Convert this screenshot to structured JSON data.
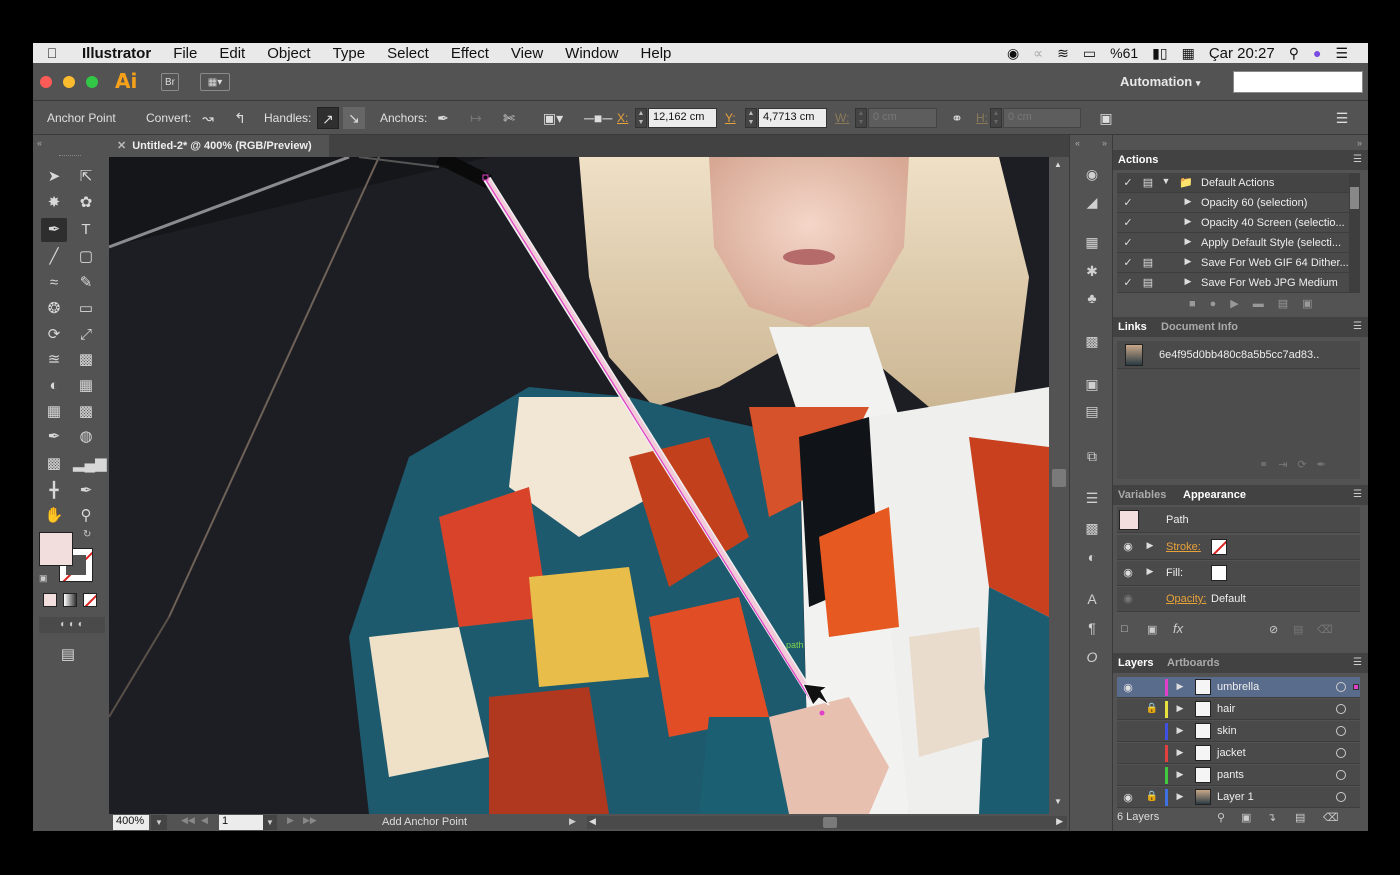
{
  "menubar": {
    "app_name": "Illustrator",
    "items": [
      "File",
      "Edit",
      "Object",
      "Type",
      "Select",
      "Effect",
      "View",
      "Window",
      "Help"
    ],
    "battery": "%61",
    "clock": "Çar 20:27"
  },
  "appbar": {
    "logo": "Ai",
    "bridge_label": "Br",
    "workspace": "Automation",
    "search_placeholder": ""
  },
  "control_bar": {
    "tool_name": "Anchor Point",
    "convert_label": "Convert:",
    "handles_label": "Handles:",
    "anchors_label": "Anchors:",
    "x_label": "X:",
    "x_value": "12,162 cm",
    "y_label": "Y:",
    "y_value": "4,7713 cm",
    "w_label": "W:",
    "w_value": "0 cm",
    "h_label": "H:",
    "h_value": "0 cm"
  },
  "document": {
    "tab_title": "Untitled-2* @ 400% (RGB/Preview)",
    "smart_guide_label": "path"
  },
  "status_bar": {
    "zoom": "400%",
    "artboard": "1",
    "current_tool": "Add Anchor Point"
  },
  "actions_panel": {
    "title": "Actions",
    "set_name": "Default Actions",
    "items": [
      "Opacity 60 (selection)",
      "Opacity 40 Screen (selectio...",
      "Apply Default Style (selecti...",
      "Save For Web GIF 64 Dither...",
      "Save For Web JPG Medium"
    ]
  },
  "links_panel": {
    "tab_links": "Links",
    "tab_doc_info": "Document Info",
    "link_name": "6e4f95d0bb480c8a5b5cc7ad83.."
  },
  "appearance_panel": {
    "tab_variables": "Variables",
    "tab_appearance": "Appearance",
    "object_type": "Path",
    "stroke_label": "Stroke:",
    "fill_label": "Fill:",
    "opacity_label": "Opacity:",
    "opacity_value": "Default"
  },
  "layers_panel": {
    "tab_layers": "Layers",
    "tab_artboards": "Artboards",
    "layers": [
      {
        "name": "umbrella",
        "color": "#e040c8"
      },
      {
        "name": "hair",
        "color": "#e8e040"
      },
      {
        "name": "skin",
        "color": "#4050e0"
      },
      {
        "name": "jacket",
        "color": "#e04040"
      },
      {
        "name": "pants",
        "color": "#40c840"
      },
      {
        "name": "Layer 1",
        "color": "#4070e0"
      }
    ],
    "count_label": "6 Layers"
  },
  "colors": {
    "fill_swatch": "#f3dede",
    "ai_orange": "#f7a11a",
    "selection_magenta": "#e040c8"
  }
}
